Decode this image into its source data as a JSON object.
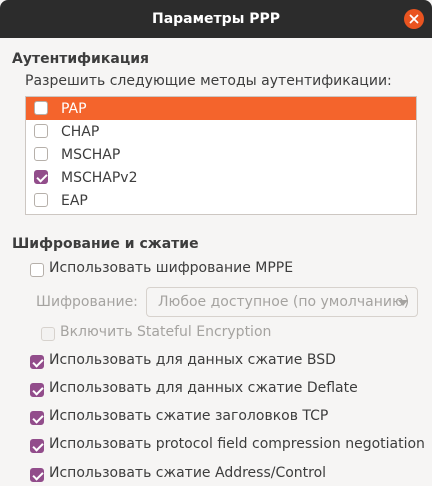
{
  "window": {
    "title": "Параметры PPP"
  },
  "auth": {
    "heading": "Аутентификация",
    "allow_label": "Разрешить следующие методы аутентификации:",
    "methods": [
      {
        "label": "PAP",
        "checked": false,
        "selected": true
      },
      {
        "label": "CHAP",
        "checked": false,
        "selected": false
      },
      {
        "label": "MSCHAP",
        "checked": false,
        "selected": false
      },
      {
        "label": "MSCHAPv2",
        "checked": true,
        "selected": false
      },
      {
        "label": "EAP",
        "checked": false,
        "selected": false
      }
    ]
  },
  "encryption": {
    "heading": "Шифрование и сжатие",
    "use_mppe_label": "Использовать шифрование MPPE",
    "cipher_label": "Шифрование:",
    "cipher_value": "Любое доступное (по умолчанию)",
    "stateful_label": "Включить Stateful Encryption",
    "options": [
      {
        "label": "Использовать для данных сжатие BSD",
        "checked": true
      },
      {
        "label": "Использовать для данных сжатие Deflate",
        "checked": true
      },
      {
        "label": "Использовать сжатие заголовков TCP",
        "checked": true
      },
      {
        "label": "Использовать protocol field compression negotiation",
        "checked": true
      },
      {
        "label": "Использовать сжатие Address/Control",
        "checked": true
      }
    ]
  },
  "colors": {
    "accent": "#f4642c",
    "check": "#924d8b",
    "titlebar": "#2c2c2c",
    "close": "#e95420"
  }
}
